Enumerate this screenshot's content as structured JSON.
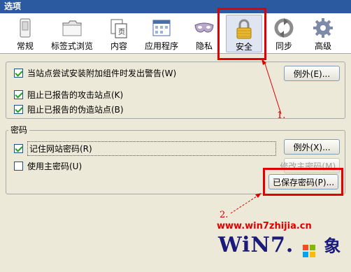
{
  "window": {
    "title": "选项"
  },
  "tabs": [
    {
      "label": "常规",
      "icon": "switch-icon"
    },
    {
      "label": "标签式浏览",
      "icon": "folder-tabs-icon"
    },
    {
      "label": "内容",
      "icon": "page-icon"
    },
    {
      "label": "应用程序",
      "icon": "application-icon"
    },
    {
      "label": "隐私",
      "icon": "mask-icon"
    },
    {
      "label": "安全",
      "icon": "lock-icon",
      "selected": true
    },
    {
      "label": "同步",
      "icon": "sync-icon"
    },
    {
      "label": "高级",
      "icon": "gear-icon"
    }
  ],
  "security": {
    "warn_addons": {
      "label": "当站点尝试安装附加组件时发出警告(W)",
      "checked": true
    },
    "exceptions_label": "例外(E)...",
    "block_attack": {
      "label": "阻止已报告的攻击站点(K)",
      "checked": true
    },
    "block_forgery": {
      "label": "阻止已报告的伪造站点(B)",
      "checked": true
    }
  },
  "passwords": {
    "legend": "密码",
    "remember": {
      "label": "记住网站密码(R)",
      "checked": true
    },
    "exceptions_label": "例外(X)...",
    "master": {
      "label": "使用主密码(U)",
      "checked": false
    },
    "change_master_label": "修改主密码(M)...",
    "saved_label": "已保存密码(P)..."
  },
  "annotations": {
    "step1": "1.",
    "step2": "2.",
    "watermark": "www.win7zhijia.cn",
    "logo": "WiN7.",
    "logo_suffix": "象",
    "colors": {
      "highlight": "#e00000",
      "titlebar": "#2c5aa0"
    }
  }
}
